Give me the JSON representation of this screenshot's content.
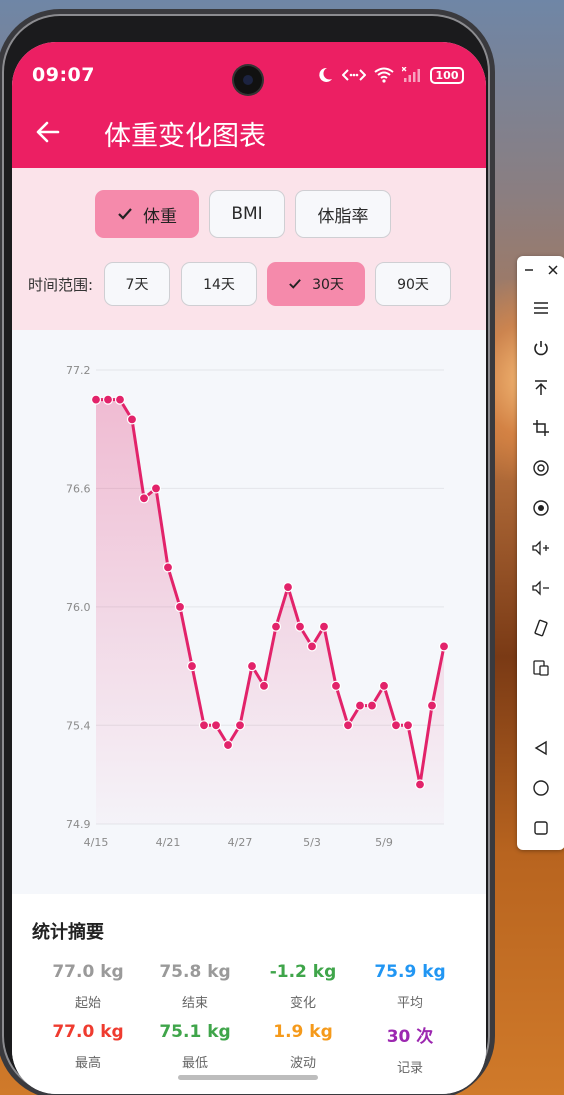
{
  "status_bar": {
    "time": "09:07",
    "battery": "100"
  },
  "header": {
    "title": "体重变化图表"
  },
  "metric_tabs": [
    {
      "label": "体重",
      "selected": true
    },
    {
      "label": "BMI",
      "selected": false
    },
    {
      "label": "体脂率",
      "selected": false
    }
  ],
  "range": {
    "label": "时间范围:",
    "options": [
      {
        "label": "7天",
        "selected": false
      },
      {
        "label": "14天",
        "selected": false
      },
      {
        "label": "30天",
        "selected": true
      },
      {
        "label": "90天",
        "selected": false
      }
    ]
  },
  "chart_data": {
    "type": "area",
    "x_ticks": [
      "4/15",
      "4/21",
      "4/27",
      "5/3",
      "5/9"
    ],
    "y_ticks": [
      "77.2",
      "76.6",
      "76.0",
      "75.4",
      "74.9"
    ],
    "ylim": [
      74.9,
      77.2
    ],
    "grid": true,
    "legend": "none",
    "series": [
      {
        "color": "#e2236a",
        "x": [
          "4/15",
          "4/16",
          "4/17",
          "4/18",
          "4/19",
          "4/20",
          "4/21",
          "4/22",
          "4/23",
          "4/24",
          "4/25",
          "4/26",
          "4/27",
          "4/28",
          "4/29",
          "4/30",
          "5/1",
          "5/2",
          "5/3",
          "5/4",
          "5/5",
          "5/6",
          "5/7",
          "5/8",
          "5/9",
          "5/10",
          "5/11",
          "5/12",
          "5/13",
          "5/14"
        ],
        "values": [
          77.05,
          77.05,
          77.05,
          76.95,
          76.55,
          76.6,
          76.2,
          76.0,
          75.7,
          75.4,
          75.4,
          75.3,
          75.4,
          75.7,
          75.6,
          75.9,
          76.1,
          75.9,
          75.8,
          75.9,
          75.6,
          75.4,
          75.5,
          75.5,
          75.6,
          75.4,
          75.4,
          75.1,
          75.5,
          75.8
        ]
      }
    ]
  },
  "summary": {
    "title": "统计摘要",
    "stats": [
      {
        "value": "77.0 kg",
        "label": "起始",
        "color": "#9a9a9a"
      },
      {
        "value": "75.8 kg",
        "label": "结束",
        "color": "#9a9a9a"
      },
      {
        "value": "-1.2 kg",
        "label": "变化",
        "color": "#3fa54a"
      },
      {
        "value": "75.9 kg",
        "label": "平均",
        "color": "#2196f3"
      },
      {
        "value": "77.0 kg",
        "label": "最高",
        "color": "#ef3b2f"
      },
      {
        "value": "75.1 kg",
        "label": "最低",
        "color": "#3fa54a"
      },
      {
        "value": "1.9 kg",
        "label": "波动",
        "color": "#f59a1b"
      },
      {
        "value": "30 次",
        "label": "记录",
        "color": "#9c27b0"
      }
    ]
  },
  "colors": {
    "accent": "#ec1f63",
    "chip_selected": "#f58aab",
    "panel": "#fbe3ea"
  },
  "toolbar": {
    "icons": [
      "minimize-icon",
      "close-icon",
      "menu-icon",
      "power-icon",
      "upload-icon",
      "crop-icon",
      "screenshot-icon",
      "record-icon",
      "volume-up-icon",
      "volume-down-icon",
      "rotate-icon",
      "screen-mirror-icon",
      "back-nav-icon",
      "home-nav-icon",
      "recents-nav-icon"
    ]
  }
}
